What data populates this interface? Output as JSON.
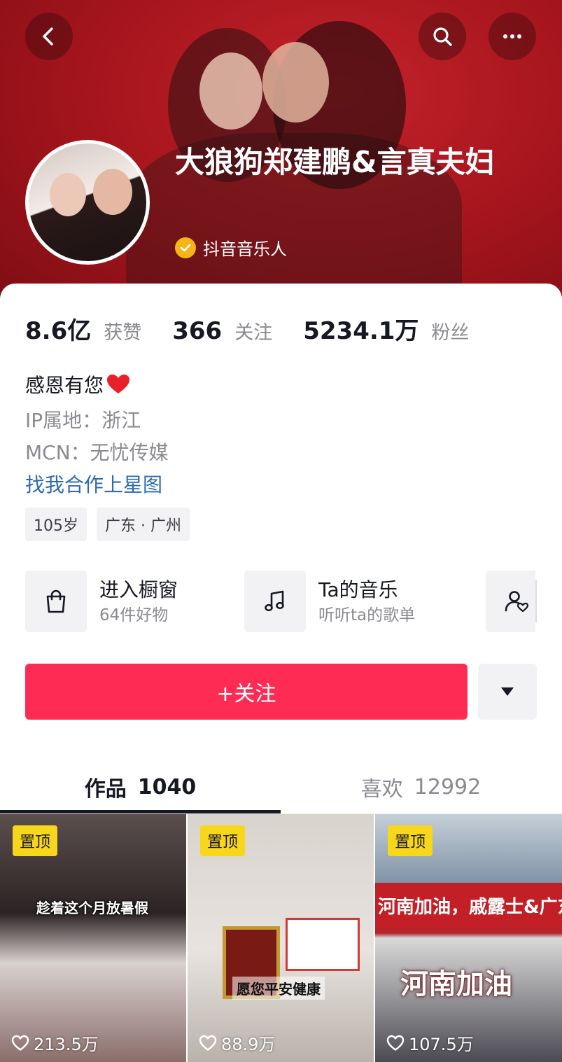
{
  "profile": {
    "name": "大狼狗郑建鹏&言真夫妇",
    "verified_label": "抖音音乐人"
  },
  "stats": [
    {
      "value": "8.6亿",
      "label": "获赞"
    },
    {
      "value": "366",
      "label": "关注"
    },
    {
      "value": "5234.1万",
      "label": "粉丝"
    }
  ],
  "bio": {
    "text": "感恩有您",
    "ip": "IP属地：浙江",
    "mcn": "MCN：无忧传媒",
    "link": "找我合作上星图"
  },
  "tags": [
    "105岁",
    "广东 · 广州"
  ],
  "entries": [
    {
      "icon": "shopping-bag-icon",
      "title": "进入橱窗",
      "subtitle": "64件好物"
    },
    {
      "icon": "music-note-icon",
      "title": "Ta的音乐",
      "subtitle": "听听ta的歌单"
    },
    {
      "icon": "user-heart-icon"
    }
  ],
  "actions": {
    "follow_label": "+关注"
  },
  "tabs": [
    {
      "label": "作品",
      "count": "1040"
    },
    {
      "label": "喜欢",
      "count": "12992"
    }
  ],
  "videos": [
    {
      "pin": "置顶",
      "caption": "趁着这个月放暑假",
      "likes": "213.5万"
    },
    {
      "pin": "置顶",
      "caption": "愿您平安健康",
      "likes": "88.9万"
    },
    {
      "pin": "置顶",
      "banner": "河南加油，戚露士&广东夫妇驰援河南防汛物资",
      "caption": "河南加油",
      "likes": "107.5万"
    }
  ],
  "colors": {
    "header_red": "#a3141c",
    "follow_pink": "#fe2c55",
    "link_blue": "#2c6ab0",
    "pin_yellow": "#f8d61c",
    "verify_gold": "#f5b418"
  }
}
